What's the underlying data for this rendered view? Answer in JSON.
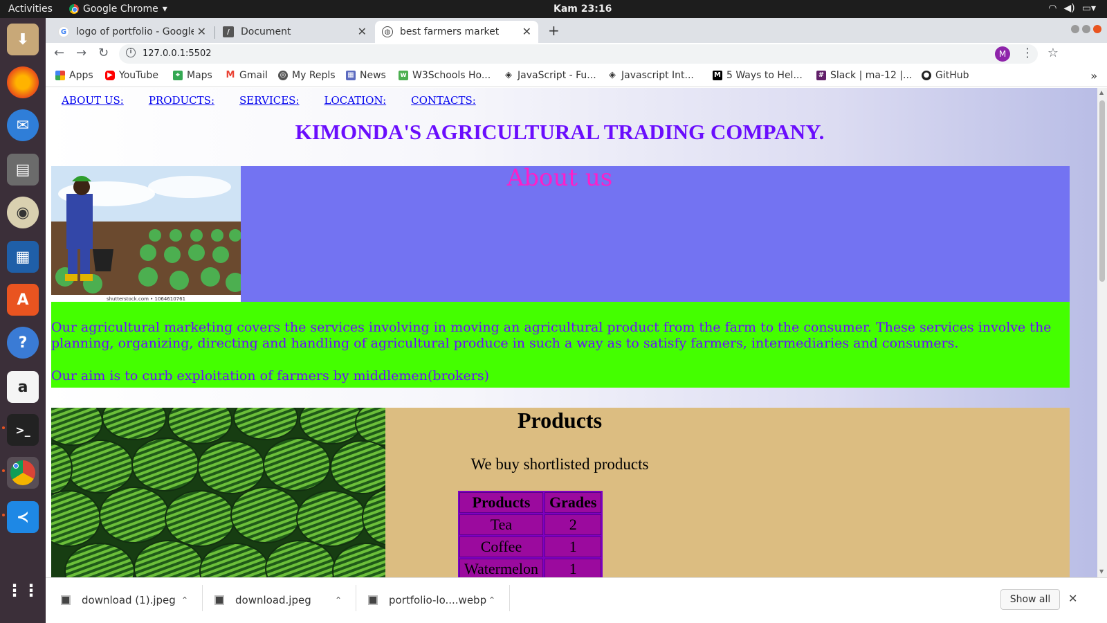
{
  "system": {
    "activities": "Activities",
    "app_name": "Google Chrome",
    "clock": "Kam 23:16"
  },
  "tabs": [
    {
      "title": "logo of portfolio - Google",
      "active": false
    },
    {
      "title": "Document",
      "active": false
    },
    {
      "title": "best farmers market",
      "active": true
    }
  ],
  "address_bar": {
    "url": "127.0.0.1:5502"
  },
  "profile_initial": "M",
  "bookmarks": [
    {
      "label": "Apps",
      "icon": "apps-grid-icon"
    },
    {
      "label": "YouTube",
      "icon": "youtube-icon"
    },
    {
      "label": "Maps",
      "icon": "maps-icon"
    },
    {
      "label": "Gmail",
      "icon": "gmail-icon"
    },
    {
      "label": "My Repls",
      "icon": "replit-icon"
    },
    {
      "label": "News",
      "icon": "news-icon"
    },
    {
      "label": "W3Schools Ho...",
      "icon": "w3schools-icon"
    },
    {
      "label": "JavaScript - Fu...",
      "icon": "diamond-icon"
    },
    {
      "label": "Javascript Int...",
      "icon": "diamond-icon"
    },
    {
      "label": "5 Ways to Hel...",
      "icon": "medium-icon"
    },
    {
      "label": "Slack | ma-12 |...",
      "icon": "slack-icon"
    },
    {
      "label": "GitHub",
      "icon": "github-icon"
    }
  ],
  "page": {
    "nav": [
      "ABOUT US:",
      "PRODUCTS:",
      "SERVICES:",
      "LOCATION:",
      "CONTACTS:"
    ],
    "company_title": "KIMONDA'S AGRICULTURAL TRADING COMPANY.",
    "about": {
      "title": "About us",
      "image_caption": "shutterstock.com • 1064610761",
      "paragraph_1": "Our agricultural marketing covers the services involving in moving an agricultural product from the farm to the consumer. These services involve the planning, organizing, directing and handling of agricultural produce in such a way as to satisfy farmers, intermediaries and consumers.",
      "paragraph_2": "Our aim is to curb exploitation of farmers by middlemen(brokers)"
    },
    "products": {
      "title": "Products",
      "subtitle": "We buy shortlisted products",
      "table_headers": [
        "Products",
        "Grades"
      ],
      "table_rows": [
        [
          "Tea",
          "2"
        ],
        [
          "Coffee",
          "1"
        ],
        [
          "Watermelon",
          "1"
        ]
      ]
    }
  },
  "downloads": {
    "items": [
      "download (1).jpeg",
      "download.jpeg",
      "portfolio-lo....webp"
    ],
    "show_all": "Show all"
  },
  "colors": {
    "company_title": "#6a0dfd",
    "about_band": "#7373f2",
    "about_title": "#ff1ec8",
    "about_text_bg": "#44ff00",
    "products_band": "#dcbd81",
    "table_cell": "#9b0a9e"
  }
}
